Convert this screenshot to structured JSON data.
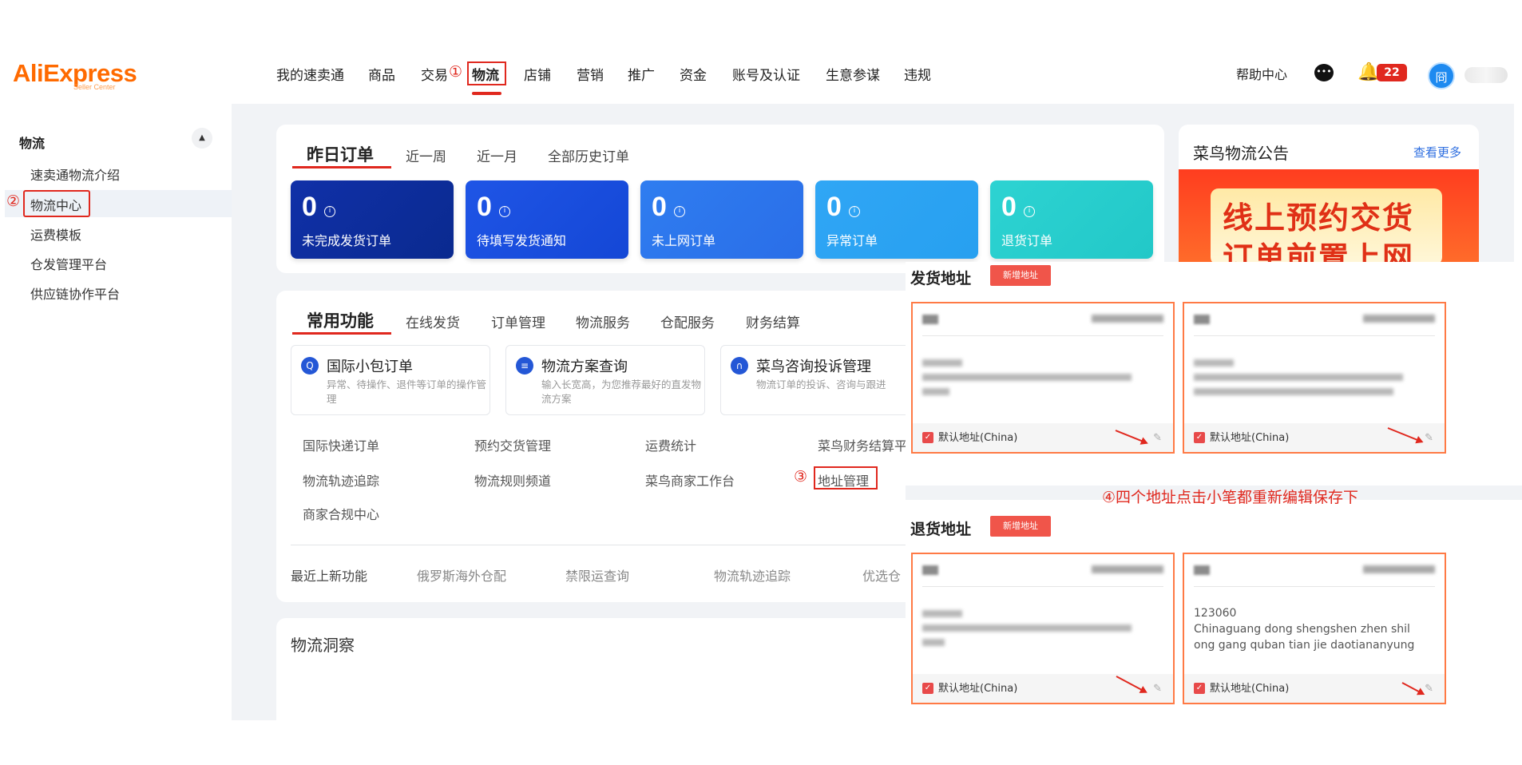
{
  "logo": {
    "main": "AliExpress",
    "sub": "Seller Center"
  },
  "nav": {
    "items": [
      "我的速卖通",
      "商品",
      "交易",
      "物流",
      "店铺",
      "营销",
      "推广",
      "资金",
      "账号及认证",
      "生意参谋",
      "违规"
    ],
    "help": "帮助中心",
    "notif_count": "22",
    "avatar_char": "冏"
  },
  "annotations": {
    "step1": "①",
    "step2": "②",
    "step3": "③",
    "step4_note": "④四个地址点击小笔都重新编辑保存下"
  },
  "sidebar": {
    "title": "物流",
    "items": [
      "速卖通物流介绍",
      "物流中心",
      "运费模板",
      "仓发管理平台",
      "供应链协作平台"
    ]
  },
  "orders": {
    "tabs": [
      "昨日订单",
      "近一周",
      "近一月",
      "全部历史订单"
    ],
    "stats": [
      {
        "value": "0",
        "label": "未完成发货订单"
      },
      {
        "value": "0",
        "label": "待填写发货通知"
      },
      {
        "value": "0",
        "label": "未上网订单"
      },
      {
        "value": "0",
        "label": "异常订单"
      },
      {
        "value": "0",
        "label": "退货订单"
      }
    ]
  },
  "functions": {
    "tabs": [
      "常用功能",
      "在线发货",
      "订单管理",
      "物流服务",
      "仓配服务",
      "财务结算"
    ],
    "cards": [
      {
        "title": "国际小包订单",
        "desc": "异常、待操作、退件等订单的操作管理"
      },
      {
        "title": "物流方案查询",
        "desc": "输入长宽高，为您推荐最好的直发物流方案"
      },
      {
        "title": "菜鸟咨询投诉管理",
        "desc": "物流订单的投诉、咨询与跟进"
      }
    ],
    "links": [
      "国际快递订单",
      "预约交货管理",
      "运费统计",
      "菜鸟财务结算平",
      "物流轨迹追踪",
      "物流规则频道",
      "菜鸟商家工作台",
      "地址管理",
      "商家合规中心"
    ],
    "recent_label": "最近上新功能",
    "recent": [
      "俄罗斯海外仓配",
      "禁限运查询",
      "物流轨迹追踪",
      "优选仓"
    ]
  },
  "insight": {
    "title": "物流洞察"
  },
  "announcement": {
    "title": "菜鸟物流公告",
    "more": "查看更多",
    "banner_line1": "线上预约交货",
    "banner_line2": "订单前置上网"
  },
  "address": {
    "ship_title": "发货地址",
    "return_title": "退货地址",
    "add_button": "新增地址",
    "default_label": "默认地址(China)",
    "return_card2_lines": [
      "123060",
      "Chinaguang dong shengshen zhen shil",
      "ong gang quban tian jie daotiananyung"
    ]
  }
}
